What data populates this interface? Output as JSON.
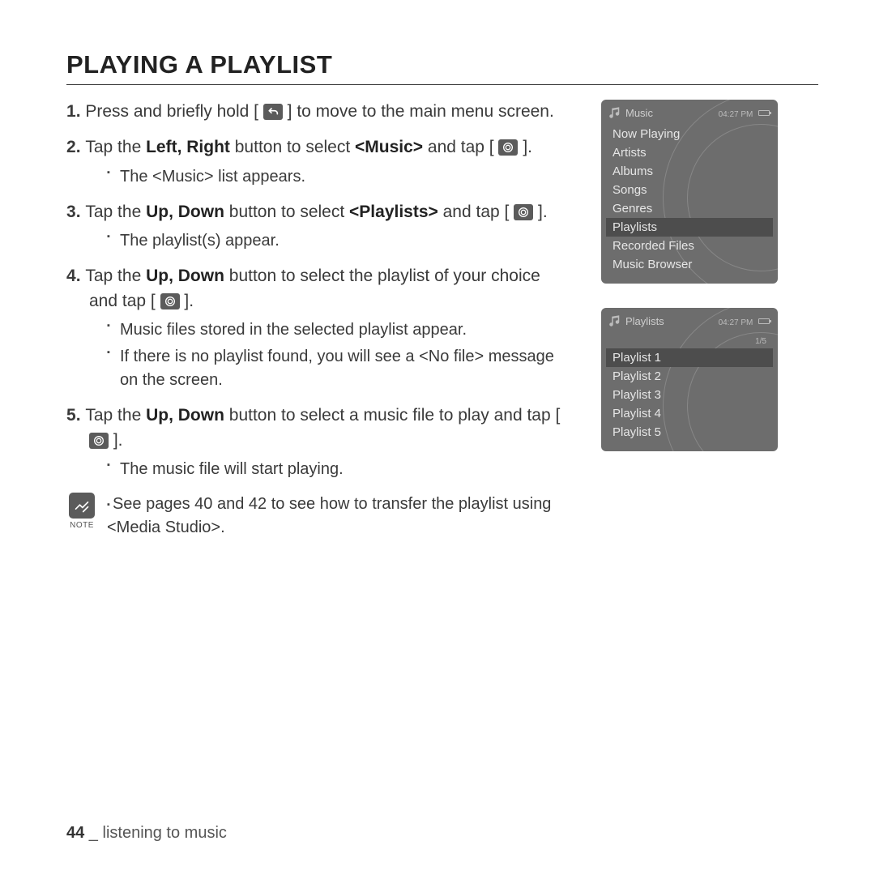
{
  "title": "PLAYING A PLAYLIST",
  "steps": {
    "s1a": "Press and briefly hold [",
    "s1b": "] to move to the main menu screen.",
    "s2a": "Tap the ",
    "s2b": "Left, Right",
    "s2c": " button to select ",
    "s2d": "<Music>",
    "s2e": " and tap [",
    "s2f": "].",
    "s2sub1": "The <Music> list appears.",
    "s3a": "Tap the ",
    "s3b": "Up, Down",
    "s3c": " button to select ",
    "s3d": "<Playlists>",
    "s3e": " and tap [",
    "s3f": "].",
    "s3sub1": "The playlist(s) appear.",
    "s4a": "Tap the ",
    "s4b": "Up, Down",
    "s4c": " button to select the playlist of your choice and tap [",
    "s4d": "].",
    "s4sub1": "Music files stored in the selected playlist appear.",
    "s4sub2": "If there is no playlist found, you will see a <No file> message on the screen.",
    "s5a": "Tap the ",
    "s5b": "Up, Down",
    "s5c": " button to select a music file to play and tap [",
    "s5d": "].",
    "s5sub1": "The music file will start playing."
  },
  "note": {
    "label": "NOTE",
    "text": "See pages 40 and 42 to see how to transfer the playlist using <Media Studio>."
  },
  "device1": {
    "headerTitle": "Music",
    "time": "04:27 PM",
    "items": [
      "Now Playing",
      "Artists",
      "Albums",
      "Songs",
      "Genres",
      "Playlists",
      "Recorded Files",
      "Music Browser"
    ],
    "selectedIndex": 5
  },
  "device2": {
    "headerTitle": "Playlists",
    "time": "04:27 PM",
    "counter": "1/5",
    "items": [
      "Playlist 1",
      "Playlist 2",
      "Playlist 3",
      "Playlist 4",
      "Playlist 5"
    ],
    "selectedIndex": 0
  },
  "footer": {
    "page": "44",
    "sep": " _ ",
    "section": "listening to music"
  }
}
